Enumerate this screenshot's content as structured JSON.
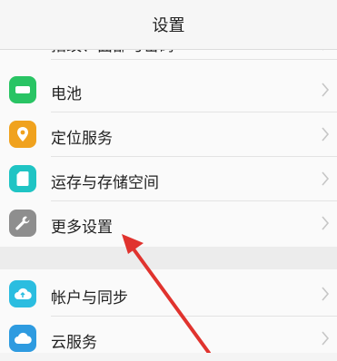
{
  "header": {
    "title": "设置"
  },
  "rows": [
    {
      "name": "partial-row",
      "label": "指纹、面部与密码",
      "icon": "fingerprint-icon",
      "color": "#9a6bd6"
    },
    {
      "name": "battery",
      "label": "电池",
      "icon": "battery-icon",
      "color": "#29c464"
    },
    {
      "name": "location-services",
      "label": "定位服务",
      "icon": "location-pin-icon",
      "color": "#f0a21e"
    },
    {
      "name": "storage",
      "label": "运存与存储空间",
      "icon": "storage-icon",
      "color": "#1fc4c4"
    },
    {
      "name": "more-settings",
      "label": "更多设置",
      "icon": "wrench-icon",
      "color": "#8e8e8e"
    },
    {
      "name": "accounts-sync",
      "label": "帐户与同步",
      "icon": "cloud-upload-icon",
      "color": "#2bbde0"
    },
    {
      "name": "cloud-service",
      "label": "云服务",
      "icon": "cloud-icon",
      "color": "#2e9be0"
    }
  ],
  "annotation": {
    "arrow_color": "#e0332e",
    "points_to": "更多设置"
  }
}
